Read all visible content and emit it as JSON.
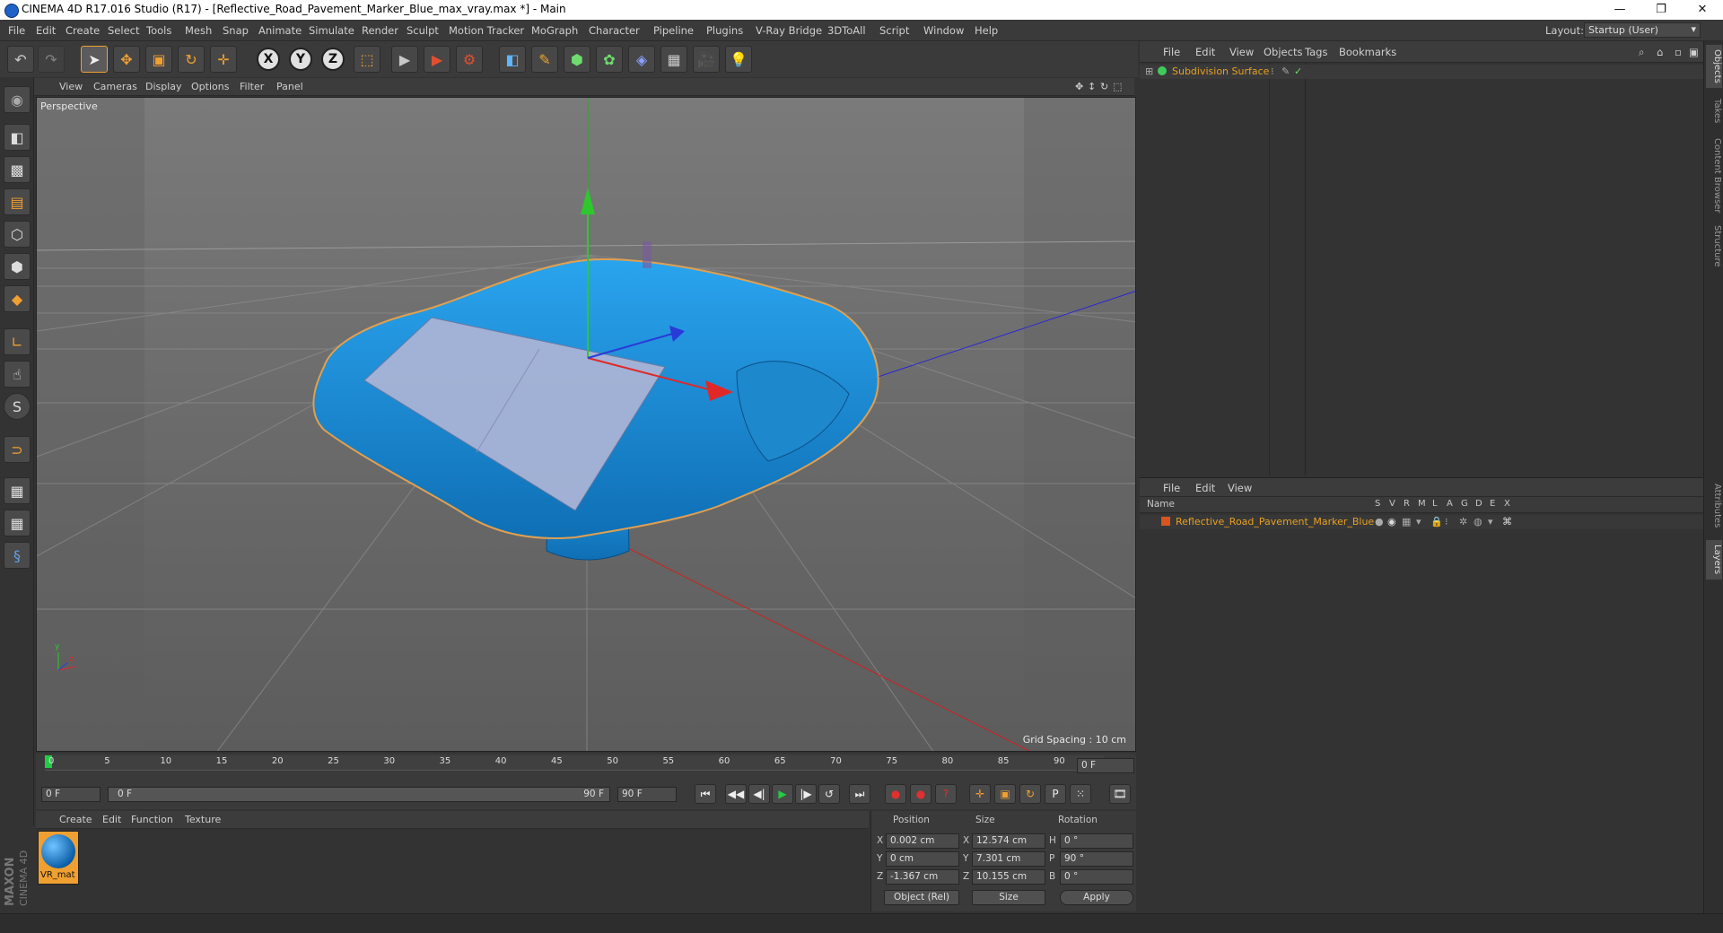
{
  "window": {
    "title": "CINEMA 4D R17.016 Studio (R17) - [Reflective_Road_Pavement_Marker_Blue_max_vray.max *] - Main",
    "minimize": "—",
    "restore": "❐",
    "close": "✕"
  },
  "menu": [
    "File",
    "Edit",
    "Create",
    "Select",
    "Tools",
    "Mesh",
    "Snap",
    "Animate",
    "Simulate",
    "Render",
    "Sculpt",
    "Motion Tracker",
    "MoGraph",
    "Character",
    "Pipeline",
    "Plugins",
    "V-Ray Bridge",
    "3DToAll",
    "Script",
    "Window",
    "Help"
  ],
  "layout": {
    "label": "Layout:",
    "value": "Startup (User)"
  },
  "toolbar": {
    "undo": "↶",
    "redo": "↷",
    "select": "➤",
    "move": "✥",
    "scale": "▣",
    "rotate": "↻",
    "live": "✛",
    "axis_x": "X",
    "axis_y": "Y",
    "axis_z": "Z",
    "coord": "⬚",
    "render_view": "▶",
    "render_pv": "▶",
    "render_settings": "⚙",
    "cube": "◧",
    "pen": "✎",
    "subdiv": "⬢",
    "cloner": "✿",
    "deformer": "◈",
    "floor": "▦",
    "camera": "🎥",
    "light": "💡"
  },
  "viewport": {
    "menu": [
      "View",
      "Cameras",
      "Display",
      "Options",
      "Filter",
      "Panel"
    ],
    "label": "Perspective",
    "grid_spacing": "Grid Spacing : 10 cm",
    "axis_y_label": "y",
    "axis_z_label": "z",
    "nav": [
      "✥",
      "↕",
      "↻",
      "⬚"
    ]
  },
  "timeline": {
    "ticks": [
      "0",
      "5",
      "10",
      "15",
      "20",
      "25",
      "30",
      "35",
      "40",
      "45",
      "50",
      "55",
      "60",
      "65",
      "70",
      "75",
      "80",
      "85",
      "90"
    ],
    "current": "0 F"
  },
  "transport": {
    "start": "0 F",
    "range_start": "0 F",
    "range_end": "90 F",
    "end": "90 F",
    "buttons": [
      "⏮",
      "◀◀",
      "◀|",
      "▶",
      "|▶",
      "↺",
      "⏭"
    ],
    "record": [
      "●",
      "●",
      "?"
    ],
    "key": [
      "✛",
      "▣",
      "↻",
      "P",
      "⁙",
      "🎞"
    ]
  },
  "materials": {
    "menu": [
      "Create",
      "Edit",
      "Function",
      "Texture"
    ],
    "items": [
      {
        "name": "VR_mat"
      }
    ],
    "brand_top": "MAXON",
    "brand_bottom": "CINEMA 4D"
  },
  "coords": {
    "headers": [
      "Position",
      "Size",
      "Rotation"
    ],
    "rows": [
      {
        "axis": "X",
        "pos": "0.002 cm",
        "size_axis": "X",
        "size": "12.574 cm",
        "rot_axis": "H",
        "rot": "0 °"
      },
      {
        "axis": "Y",
        "pos": "0 cm",
        "size_axis": "Y",
        "size": "7.301 cm",
        "rot_axis": "P",
        "rot": "90 °"
      },
      {
        "axis": "Z",
        "pos": "-1.367 cm",
        "size_axis": "Z",
        "size": "10.155 cm",
        "rot_axis": "B",
        "rot": "0 °"
      }
    ],
    "mode": "Object (Rel)",
    "size_mode": "Size",
    "apply": "Apply"
  },
  "objects": {
    "menu": [
      "File",
      "Edit",
      "View",
      "Objects",
      "Tags",
      "Bookmarks"
    ],
    "items": [
      {
        "name": "Subdivision Surface",
        "color": "#e8a020"
      }
    ]
  },
  "layers": {
    "menu": [
      "File",
      "Edit",
      "View"
    ],
    "header_name": "Name",
    "columns": [
      "S",
      "V",
      "R",
      "M",
      "L",
      "A",
      "G",
      "D",
      "E",
      "X"
    ],
    "items": [
      {
        "name": "Reflective_Road_Pavement_Marker_Blue",
        "color": "#e8a020",
        "swatch": "#d6561e"
      }
    ]
  },
  "right_tabs": [
    "Objects",
    "Takes",
    "Content Browser",
    "Structure",
    "Attributes",
    "Layers"
  ],
  "colors": {
    "accent": "#f0a030",
    "object_blue": "#1a86c8",
    "viewport_bg": "#6f6f6f"
  }
}
